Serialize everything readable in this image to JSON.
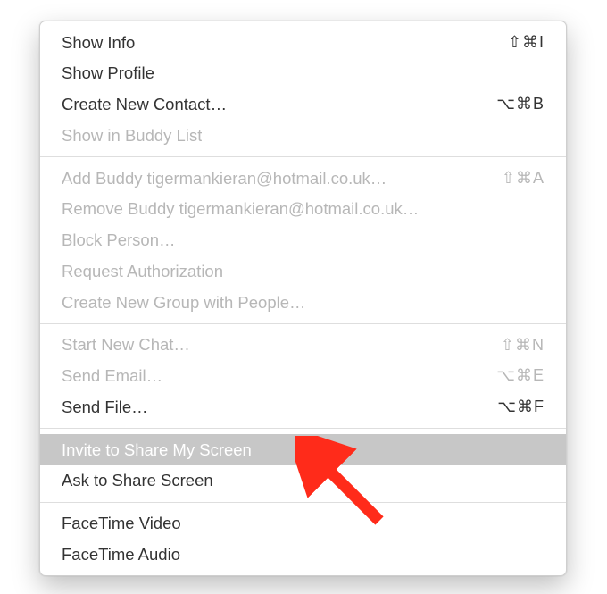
{
  "menu": {
    "sections": [
      [
        {
          "label": "Show Info",
          "shortcut": "⇧⌘I",
          "enabled": true,
          "highlighted": false,
          "name": "menu-item-show-info"
        },
        {
          "label": "Show Profile",
          "shortcut": "",
          "enabled": true,
          "highlighted": false,
          "name": "menu-item-show-profile"
        },
        {
          "label": "Create New Contact…",
          "shortcut": "⌥⌘B",
          "enabled": true,
          "highlighted": false,
          "name": "menu-item-create-new-contact"
        },
        {
          "label": "Show in Buddy List",
          "shortcut": "",
          "enabled": false,
          "highlighted": false,
          "name": "menu-item-show-in-buddy-list"
        }
      ],
      [
        {
          "label": "Add Buddy tigermankieran@hotmail.co.uk…",
          "shortcut": "⇧⌘A",
          "enabled": false,
          "highlighted": false,
          "name": "menu-item-add-buddy"
        },
        {
          "label": "Remove Buddy tigermankieran@hotmail.co.uk…",
          "shortcut": "",
          "enabled": false,
          "highlighted": false,
          "name": "menu-item-remove-buddy"
        },
        {
          "label": "Block Person…",
          "shortcut": "",
          "enabled": false,
          "highlighted": false,
          "name": "menu-item-block-person"
        },
        {
          "label": "Request Authorization",
          "shortcut": "",
          "enabled": false,
          "highlighted": false,
          "name": "menu-item-request-authorization"
        },
        {
          "label": "Create New Group with People…",
          "shortcut": "",
          "enabled": false,
          "highlighted": false,
          "name": "menu-item-create-new-group"
        }
      ],
      [
        {
          "label": "Start New Chat…",
          "shortcut": "⇧⌘N",
          "enabled": false,
          "highlighted": false,
          "name": "menu-item-start-new-chat"
        },
        {
          "label": "Send Email…",
          "shortcut": "⌥⌘E",
          "enabled": false,
          "highlighted": false,
          "name": "menu-item-send-email"
        },
        {
          "label": "Send File…",
          "shortcut": "⌥⌘F",
          "enabled": true,
          "highlighted": false,
          "name": "menu-item-send-file"
        }
      ],
      [
        {
          "label": "Invite to Share My Screen",
          "shortcut": "",
          "enabled": true,
          "highlighted": true,
          "name": "menu-item-invite-share-my-screen"
        },
        {
          "label": "Ask to Share Screen",
          "shortcut": "",
          "enabled": true,
          "highlighted": false,
          "name": "menu-item-ask-to-share-screen"
        }
      ],
      [
        {
          "label": "FaceTime Video",
          "shortcut": "",
          "enabled": true,
          "highlighted": false,
          "name": "menu-item-facetime-video"
        },
        {
          "label": "FaceTime Audio",
          "shortcut": "",
          "enabled": true,
          "highlighted": false,
          "name": "menu-item-facetime-audio"
        }
      ]
    ]
  },
  "annotation": {
    "arrow_color": "#ff2b1a"
  }
}
